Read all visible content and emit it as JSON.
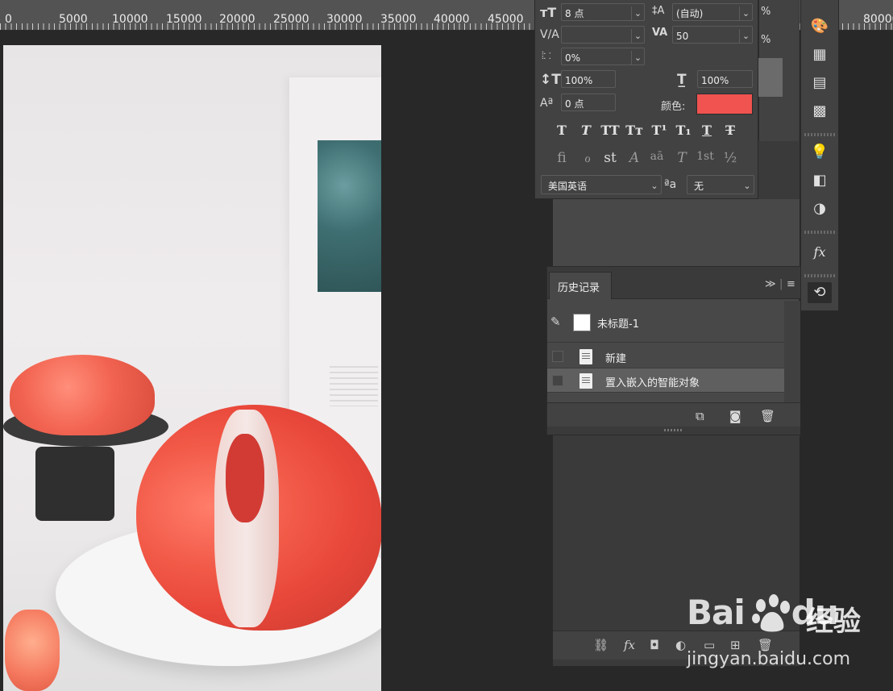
{
  "ruler": {
    "ticks": [
      "0",
      "5000",
      "10000",
      "15000",
      "20000",
      "25000",
      "30000",
      "35000",
      "40000",
      "45000",
      "80000"
    ]
  },
  "character": {
    "font_size": "8 点",
    "leading": "(自动)",
    "kerning": "",
    "tracking": "50",
    "vertical_scale_label": "0%",
    "vert_scale": "100%",
    "horiz_scale": "100%",
    "baseline_shift": "0 点",
    "color_label": "颜色:",
    "color_value": "#f05350",
    "language": "美国英语",
    "aa_label": "ªa",
    "antialias": "无",
    "style_buttons": [
      "T",
      "T",
      "TT",
      "Tт",
      "T¹",
      "T₁",
      "T",
      "T"
    ],
    "opentype_buttons": [
      "ﬁ",
      "ℴ",
      "st",
      "A",
      "aā",
      "T",
      "1st",
      "½"
    ]
  },
  "bg_panel": {
    "pct1": "%",
    "pct2": "%"
  },
  "history": {
    "tab_label": "历史记录",
    "expand": "≫",
    "menu": "≡",
    "snapshot_label": "未标题-1",
    "rows": [
      {
        "label": "新建",
        "selected": false
      },
      {
        "label": "置入嵌入的智能对象",
        "selected": true
      }
    ]
  },
  "watermark": {
    "brand": "Bai",
    "brand_suffix": "du",
    "jingyan": "经验",
    "url": "jingyan.baidu.com"
  }
}
